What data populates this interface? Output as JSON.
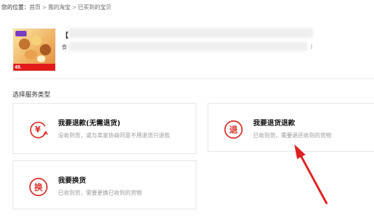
{
  "breadcrumb": {
    "label": "您的位置：",
    "items": [
      "首页",
      "我的淘宝",
      "已买到的宝贝"
    ],
    "separator": ">"
  },
  "product": {
    "title_prefix": "【",
    "subtitle_prefix": "食",
    "subtitle_suffix": ")",
    "thumbnail_price": "49."
  },
  "service": {
    "section_label": "选择服务类型",
    "options": [
      {
        "icon_char": "¥",
        "title": "我要退款(无需退货)",
        "desc": "没收到货，或与卖家协商同意不用退货只退款"
      },
      {
        "icon_char": "退",
        "title": "我要退货退款",
        "desc": "已收到货，需要退还收到的货物"
      },
      {
        "icon_char": "换",
        "title": "我要换货",
        "desc": "已收到货，需要更换已收到的货物"
      }
    ]
  },
  "colors": {
    "accent_red": "#d9322b",
    "annotation_arrow": "#e02020"
  }
}
